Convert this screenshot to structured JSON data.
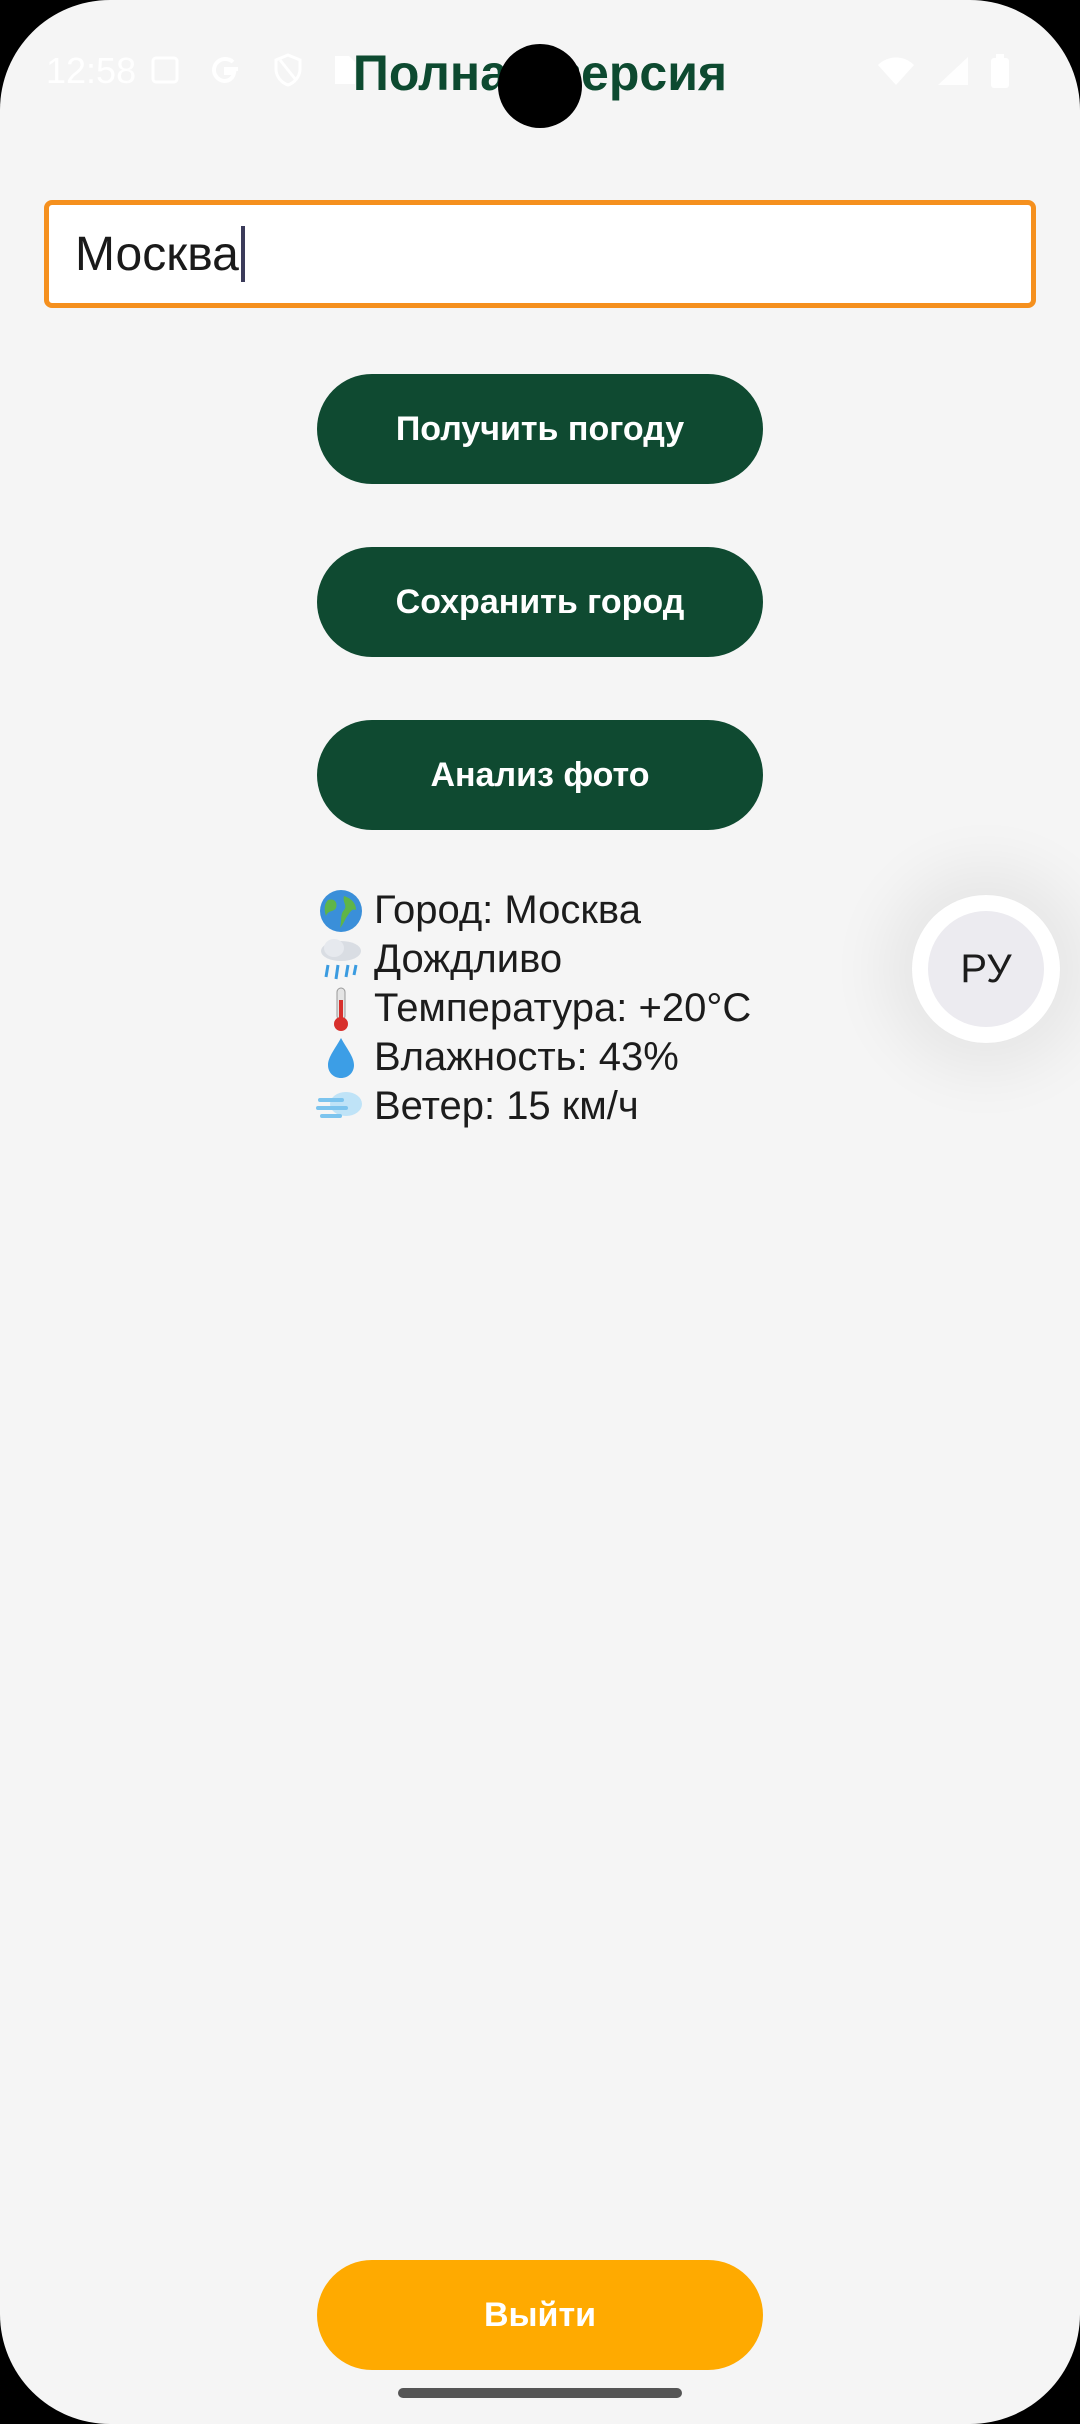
{
  "status_bar": {
    "time": "12:58"
  },
  "header": {
    "title": "Полная версия"
  },
  "city_input": {
    "value": "Москва"
  },
  "buttons": {
    "get_weather": "Получить погоду",
    "save_city": "Сохранить город",
    "photo_analysis": "Анализ фото",
    "exit": "Выйти"
  },
  "weather": {
    "lines": [
      {
        "icon": "globe-icon",
        "text": "Город: Москва"
      },
      {
        "icon": "rain-cloud-icon",
        "text": "Дождливо"
      },
      {
        "icon": "thermometer-icon",
        "text": "Температура: +20°C"
      },
      {
        "icon": "droplet-icon",
        "text": "Влажность: 43%"
      },
      {
        "icon": "wind-icon",
        "text": "Ветер: 15 км/ч"
      }
    ]
  },
  "language_button": {
    "label": "РУ"
  },
  "colors": {
    "primary_green": "#0f4a31",
    "accent_orange": "#ffaa00",
    "input_border": "#f5901e",
    "background": "#f5f5f5"
  }
}
